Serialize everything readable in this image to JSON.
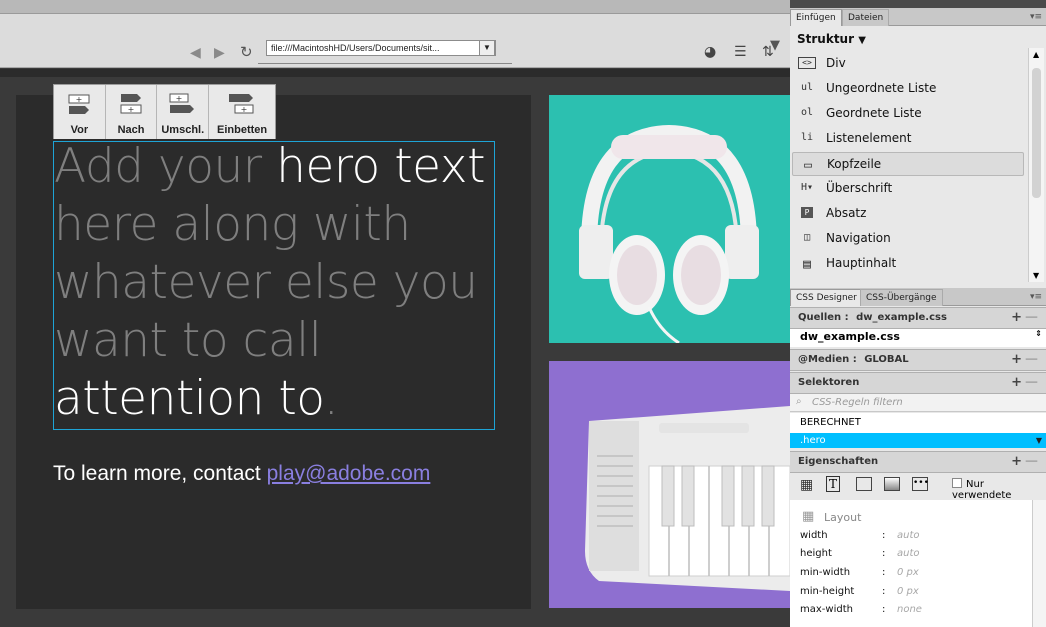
{
  "toolbar": {
    "url": "file:///MacintoshHD/Users/Documents/sit...",
    "back_icon": "back-arrow-icon",
    "forward_icon": "forward-arrow-icon",
    "refresh_icon": "refresh-icon"
  },
  "element_toolbar": {
    "items": [
      {
        "label": "Vor"
      },
      {
        "label": "Nach"
      },
      {
        "label": "Umschl."
      },
      {
        "label": "Einbetten"
      }
    ]
  },
  "hero": {
    "part1": "Add your ",
    "part2": "hero text",
    "part3": " here along with whatever else you want to call ",
    "part4": "attention to",
    "part5": ".",
    "contact_prefix": "To learn more, contact ",
    "contact_email": "play@adobe.com"
  },
  "insert_panel": {
    "tabs": [
      "Einfügen",
      "Dateien"
    ],
    "category": "Struktur",
    "items": [
      {
        "icon": "<>",
        "label": "Div"
      },
      {
        "icon": "ul",
        "label": "Ungeordnete Liste"
      },
      {
        "icon": "ol",
        "label": "Geordnete Liste"
      },
      {
        "icon": "li",
        "label": "Listenelement"
      },
      {
        "icon": "▭",
        "label": "Kopfzeile"
      },
      {
        "icon": "H▾",
        "label": "Überschrift"
      },
      {
        "icon": "P",
        "label": "Absatz"
      },
      {
        "icon": "◫",
        "label": "Navigation"
      },
      {
        "icon": "▤",
        "label": "Hauptinhalt"
      }
    ]
  },
  "css_designer": {
    "tabs": [
      "CSS Designer",
      "CSS-Übergänge"
    ],
    "sources_label": "Quellen :",
    "sources_value": "dw_example.css",
    "source_selected": "dw_example.css",
    "media_label": "@Medien :",
    "media_value": "GLOBAL",
    "selectors_label": "Selektoren",
    "filter_placeholder": "CSS-Regeln filtern",
    "computed": "BERECHNET",
    "selected_selector": ".hero",
    "properties_label": "Eigenschaften",
    "only_used_label": "Nur verwendete",
    "layout_label": "Layout",
    "props": [
      {
        "name": "width",
        "value": "auto"
      },
      {
        "name": "height",
        "value": "auto"
      },
      {
        "name": "min-width",
        "value": "0 px"
      },
      {
        "name": "min-height",
        "value": "0 px"
      },
      {
        "name": "max-width",
        "value": "none"
      }
    ]
  },
  "colors": {
    "accent": "#00bfff",
    "teal_card": "#2cc0b0",
    "purple_card": "#8e6fd0",
    "link": "#8a7fe0"
  }
}
